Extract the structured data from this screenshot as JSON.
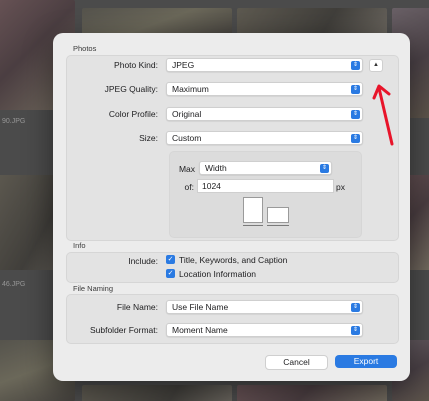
{
  "background": {
    "filename_1": "90.JPG",
    "filename_2": "46.JPG"
  },
  "dialog": {
    "photos_section_title": "Photos",
    "photo_kind": {
      "label": "Photo Kind:",
      "value": "JPEG"
    },
    "jpeg_quality": {
      "label": "JPEG Quality:",
      "value": "Maximum"
    },
    "color_profile": {
      "label": "Color Profile:",
      "value": "Original"
    },
    "size": {
      "label": "Size:",
      "value": "Custom"
    },
    "max": {
      "label": "Max",
      "value": "Width"
    },
    "of": {
      "label": "of:",
      "value": "1024",
      "unit": "px"
    },
    "info_section_title": "Info",
    "include_label": "Include:",
    "include_title_keywords": {
      "label": "Title, Keywords, and Caption",
      "checked": true
    },
    "include_location": {
      "label": "Location Information",
      "checked": true
    },
    "file_naming_section_title": "File Naming",
    "file_name": {
      "label": "File Name:",
      "value": "Use File Name"
    },
    "subfolder_format": {
      "label": "Subfolder Format:",
      "value": "Moment Name"
    },
    "cancel_label": "Cancel",
    "export_label": "Export"
  },
  "icons": {
    "popup_chevron": "chevron-updown-icon",
    "collapse": "chevron-up-icon",
    "checkbox": "checkmark-icon",
    "annotation": "red-arrow-icon"
  },
  "colors": {
    "accent": "#2a7ae2",
    "annotation_arrow": "#e8142a"
  }
}
